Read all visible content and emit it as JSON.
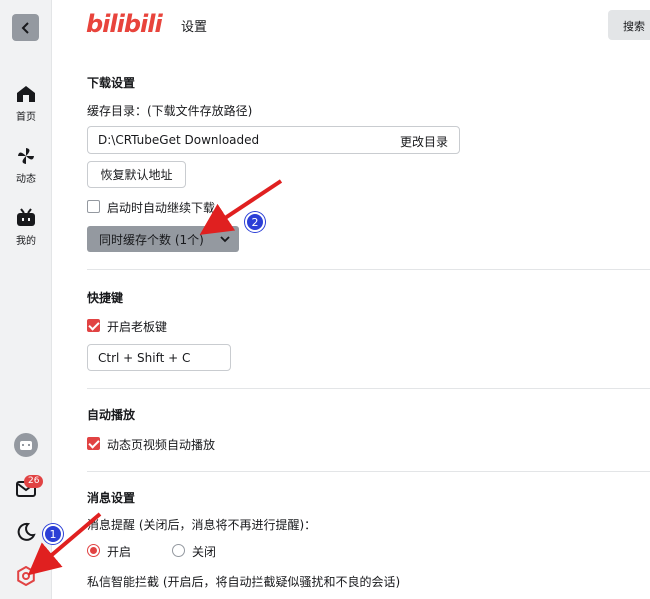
{
  "app": {
    "logo": "bilibili",
    "page_title": "设置",
    "search_label": "搜索"
  },
  "sidebar": {
    "items": [
      {
        "label": "首页",
        "icon": "home-icon"
      },
      {
        "label": "动态",
        "icon": "pinwheel-icon"
      },
      {
        "label": "我的",
        "icon": "tv-icon"
      }
    ],
    "messages_badge": "26"
  },
  "download": {
    "title": "下载设置",
    "cache_dir_label": "缓存目录：(下载文件存放路径)",
    "cache_dir_value": "D:\\CRTubeGet Downloaded",
    "change_dir_label": "更改目录",
    "restore_default_label": "恢复默认地址",
    "auto_resume_label": "启动时自动继续下载",
    "auto_resume_checked": false,
    "concurrent_label": "同时缓存个数 (1个)"
  },
  "shortcuts": {
    "title": "快捷键",
    "boss_key_label": "开启老板键",
    "boss_key_checked": true,
    "boss_key_value": "Ctrl + Shift + C"
  },
  "autoplay": {
    "title": "自动播放",
    "feed_video_label": "动态页视频自动播放",
    "feed_video_checked": true
  },
  "messages": {
    "title": "消息设置",
    "reminder_label": "消息提醒 (关闭后，消息将不再进行提醒)：",
    "on_label": "开启",
    "off_label": "关闭",
    "selected": "on",
    "dm_filter_label": "私信智能拦截 (开启后，将自动拦截疑似骚扰和不良的会话)"
  },
  "annotations": {
    "marker1": "1",
    "marker2": "2"
  },
  "colors": {
    "accent": "#e14343",
    "brand": "#e8443c",
    "marker": "#2b3fd6"
  }
}
